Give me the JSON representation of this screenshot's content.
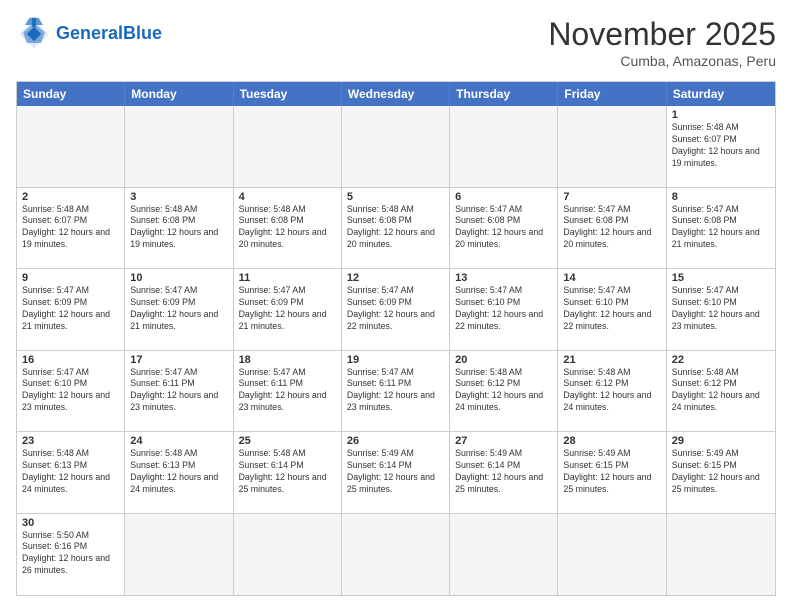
{
  "header": {
    "logo_general": "General",
    "logo_blue": "Blue",
    "month_title": "November 2025",
    "location": "Cumba, Amazonas, Peru"
  },
  "calendar": {
    "days_of_week": [
      "Sunday",
      "Monday",
      "Tuesday",
      "Wednesday",
      "Thursday",
      "Friday",
      "Saturday"
    ],
    "rows": [
      [
        {
          "day": "",
          "info": "",
          "empty": true
        },
        {
          "day": "",
          "info": "",
          "empty": true
        },
        {
          "day": "",
          "info": "",
          "empty": true
        },
        {
          "day": "",
          "info": "",
          "empty": true
        },
        {
          "day": "",
          "info": "",
          "empty": true
        },
        {
          "day": "",
          "info": "",
          "empty": true
        },
        {
          "day": "1",
          "info": "Sunrise: 5:48 AM\nSunset: 6:07 PM\nDaylight: 12 hours and 19 minutes."
        }
      ],
      [
        {
          "day": "2",
          "info": "Sunrise: 5:48 AM\nSunset: 6:07 PM\nDaylight: 12 hours and 19 minutes."
        },
        {
          "day": "3",
          "info": "Sunrise: 5:48 AM\nSunset: 6:08 PM\nDaylight: 12 hours and 19 minutes."
        },
        {
          "day": "4",
          "info": "Sunrise: 5:48 AM\nSunset: 6:08 PM\nDaylight: 12 hours and 20 minutes."
        },
        {
          "day": "5",
          "info": "Sunrise: 5:48 AM\nSunset: 6:08 PM\nDaylight: 12 hours and 20 minutes."
        },
        {
          "day": "6",
          "info": "Sunrise: 5:47 AM\nSunset: 6:08 PM\nDaylight: 12 hours and 20 minutes."
        },
        {
          "day": "7",
          "info": "Sunrise: 5:47 AM\nSunset: 6:08 PM\nDaylight: 12 hours and 20 minutes."
        },
        {
          "day": "8",
          "info": "Sunrise: 5:47 AM\nSunset: 6:08 PM\nDaylight: 12 hours and 21 minutes."
        }
      ],
      [
        {
          "day": "9",
          "info": "Sunrise: 5:47 AM\nSunset: 6:09 PM\nDaylight: 12 hours and 21 minutes."
        },
        {
          "day": "10",
          "info": "Sunrise: 5:47 AM\nSunset: 6:09 PM\nDaylight: 12 hours and 21 minutes."
        },
        {
          "day": "11",
          "info": "Sunrise: 5:47 AM\nSunset: 6:09 PM\nDaylight: 12 hours and 21 minutes."
        },
        {
          "day": "12",
          "info": "Sunrise: 5:47 AM\nSunset: 6:09 PM\nDaylight: 12 hours and 22 minutes."
        },
        {
          "day": "13",
          "info": "Sunrise: 5:47 AM\nSunset: 6:10 PM\nDaylight: 12 hours and 22 minutes."
        },
        {
          "day": "14",
          "info": "Sunrise: 5:47 AM\nSunset: 6:10 PM\nDaylight: 12 hours and 22 minutes."
        },
        {
          "day": "15",
          "info": "Sunrise: 5:47 AM\nSunset: 6:10 PM\nDaylight: 12 hours and 23 minutes."
        }
      ],
      [
        {
          "day": "16",
          "info": "Sunrise: 5:47 AM\nSunset: 6:10 PM\nDaylight: 12 hours and 23 minutes."
        },
        {
          "day": "17",
          "info": "Sunrise: 5:47 AM\nSunset: 6:11 PM\nDaylight: 12 hours and 23 minutes."
        },
        {
          "day": "18",
          "info": "Sunrise: 5:47 AM\nSunset: 6:11 PM\nDaylight: 12 hours and 23 minutes."
        },
        {
          "day": "19",
          "info": "Sunrise: 5:47 AM\nSunset: 6:11 PM\nDaylight: 12 hours and 23 minutes."
        },
        {
          "day": "20",
          "info": "Sunrise: 5:48 AM\nSunset: 6:12 PM\nDaylight: 12 hours and 24 minutes."
        },
        {
          "day": "21",
          "info": "Sunrise: 5:48 AM\nSunset: 6:12 PM\nDaylight: 12 hours and 24 minutes."
        },
        {
          "day": "22",
          "info": "Sunrise: 5:48 AM\nSunset: 6:12 PM\nDaylight: 12 hours and 24 minutes."
        }
      ],
      [
        {
          "day": "23",
          "info": "Sunrise: 5:48 AM\nSunset: 6:13 PM\nDaylight: 12 hours and 24 minutes."
        },
        {
          "day": "24",
          "info": "Sunrise: 5:48 AM\nSunset: 6:13 PM\nDaylight: 12 hours and 24 minutes."
        },
        {
          "day": "25",
          "info": "Sunrise: 5:48 AM\nSunset: 6:14 PM\nDaylight: 12 hours and 25 minutes."
        },
        {
          "day": "26",
          "info": "Sunrise: 5:49 AM\nSunset: 6:14 PM\nDaylight: 12 hours and 25 minutes."
        },
        {
          "day": "27",
          "info": "Sunrise: 5:49 AM\nSunset: 6:14 PM\nDaylight: 12 hours and 25 minutes."
        },
        {
          "day": "28",
          "info": "Sunrise: 5:49 AM\nSunset: 6:15 PM\nDaylight: 12 hours and 25 minutes."
        },
        {
          "day": "29",
          "info": "Sunrise: 5:49 AM\nSunset: 6:15 PM\nDaylight: 12 hours and 25 minutes."
        }
      ],
      [
        {
          "day": "30",
          "info": "Sunrise: 5:50 AM\nSunset: 6:16 PM\nDaylight: 12 hours and 26 minutes."
        },
        {
          "day": "",
          "info": "",
          "empty": true
        },
        {
          "day": "",
          "info": "",
          "empty": true
        },
        {
          "day": "",
          "info": "",
          "empty": true
        },
        {
          "day": "",
          "info": "",
          "empty": true
        },
        {
          "day": "",
          "info": "",
          "empty": true
        },
        {
          "day": "",
          "info": "",
          "empty": true
        }
      ]
    ]
  }
}
